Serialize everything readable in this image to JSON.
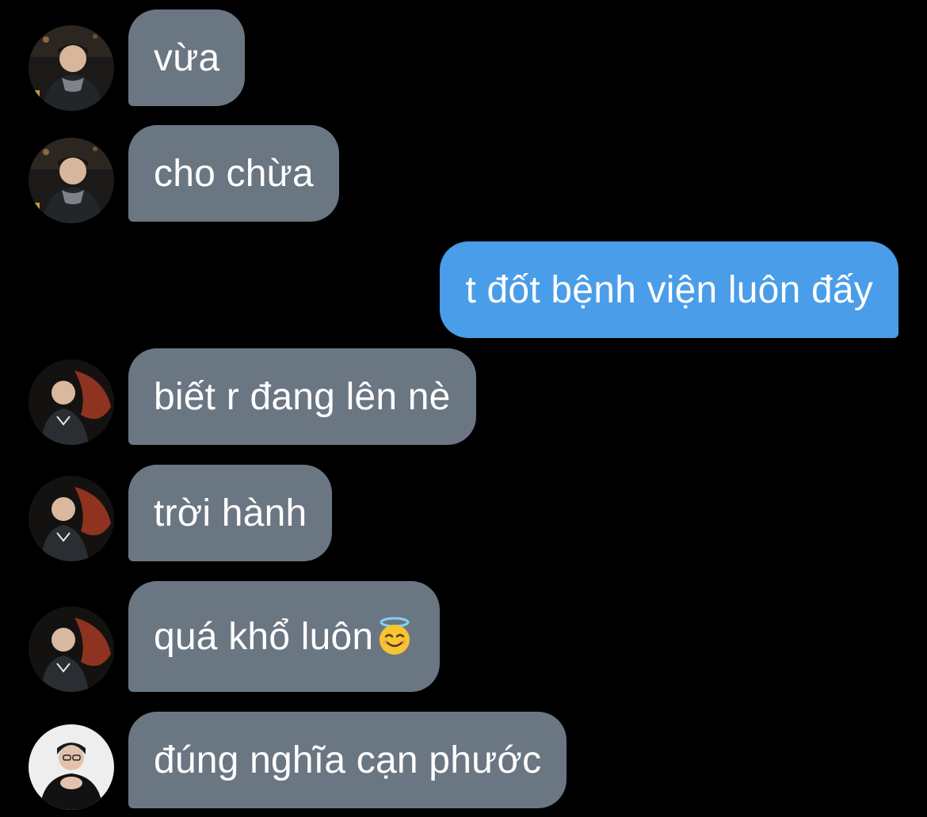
{
  "conversation": {
    "messages": [
      {
        "sender": "contact-a",
        "direction": "incoming",
        "text": "vừa"
      },
      {
        "sender": "contact-a",
        "direction": "incoming",
        "text": "cho chừa"
      },
      {
        "sender": "me",
        "direction": "outgoing",
        "text": "t đốt bệnh viện luôn đấy"
      },
      {
        "sender": "contact-b",
        "direction": "incoming",
        "text": "biết r đang lên nè"
      },
      {
        "sender": "contact-b",
        "direction": "incoming",
        "text": "trời hành"
      },
      {
        "sender": "contact-b",
        "direction": "incoming",
        "text": "quá khổ luôn",
        "emoji": "smiling-face-with-halo-emoji"
      },
      {
        "sender": "contact-c",
        "direction": "incoming",
        "text": "đúng nghĩa cạn phước"
      }
    ]
  },
  "colors": {
    "background": "#000000",
    "incoming_bubble": "#6b7683",
    "outgoing_bubble": "#4a9de8",
    "text": "#ffffff"
  }
}
